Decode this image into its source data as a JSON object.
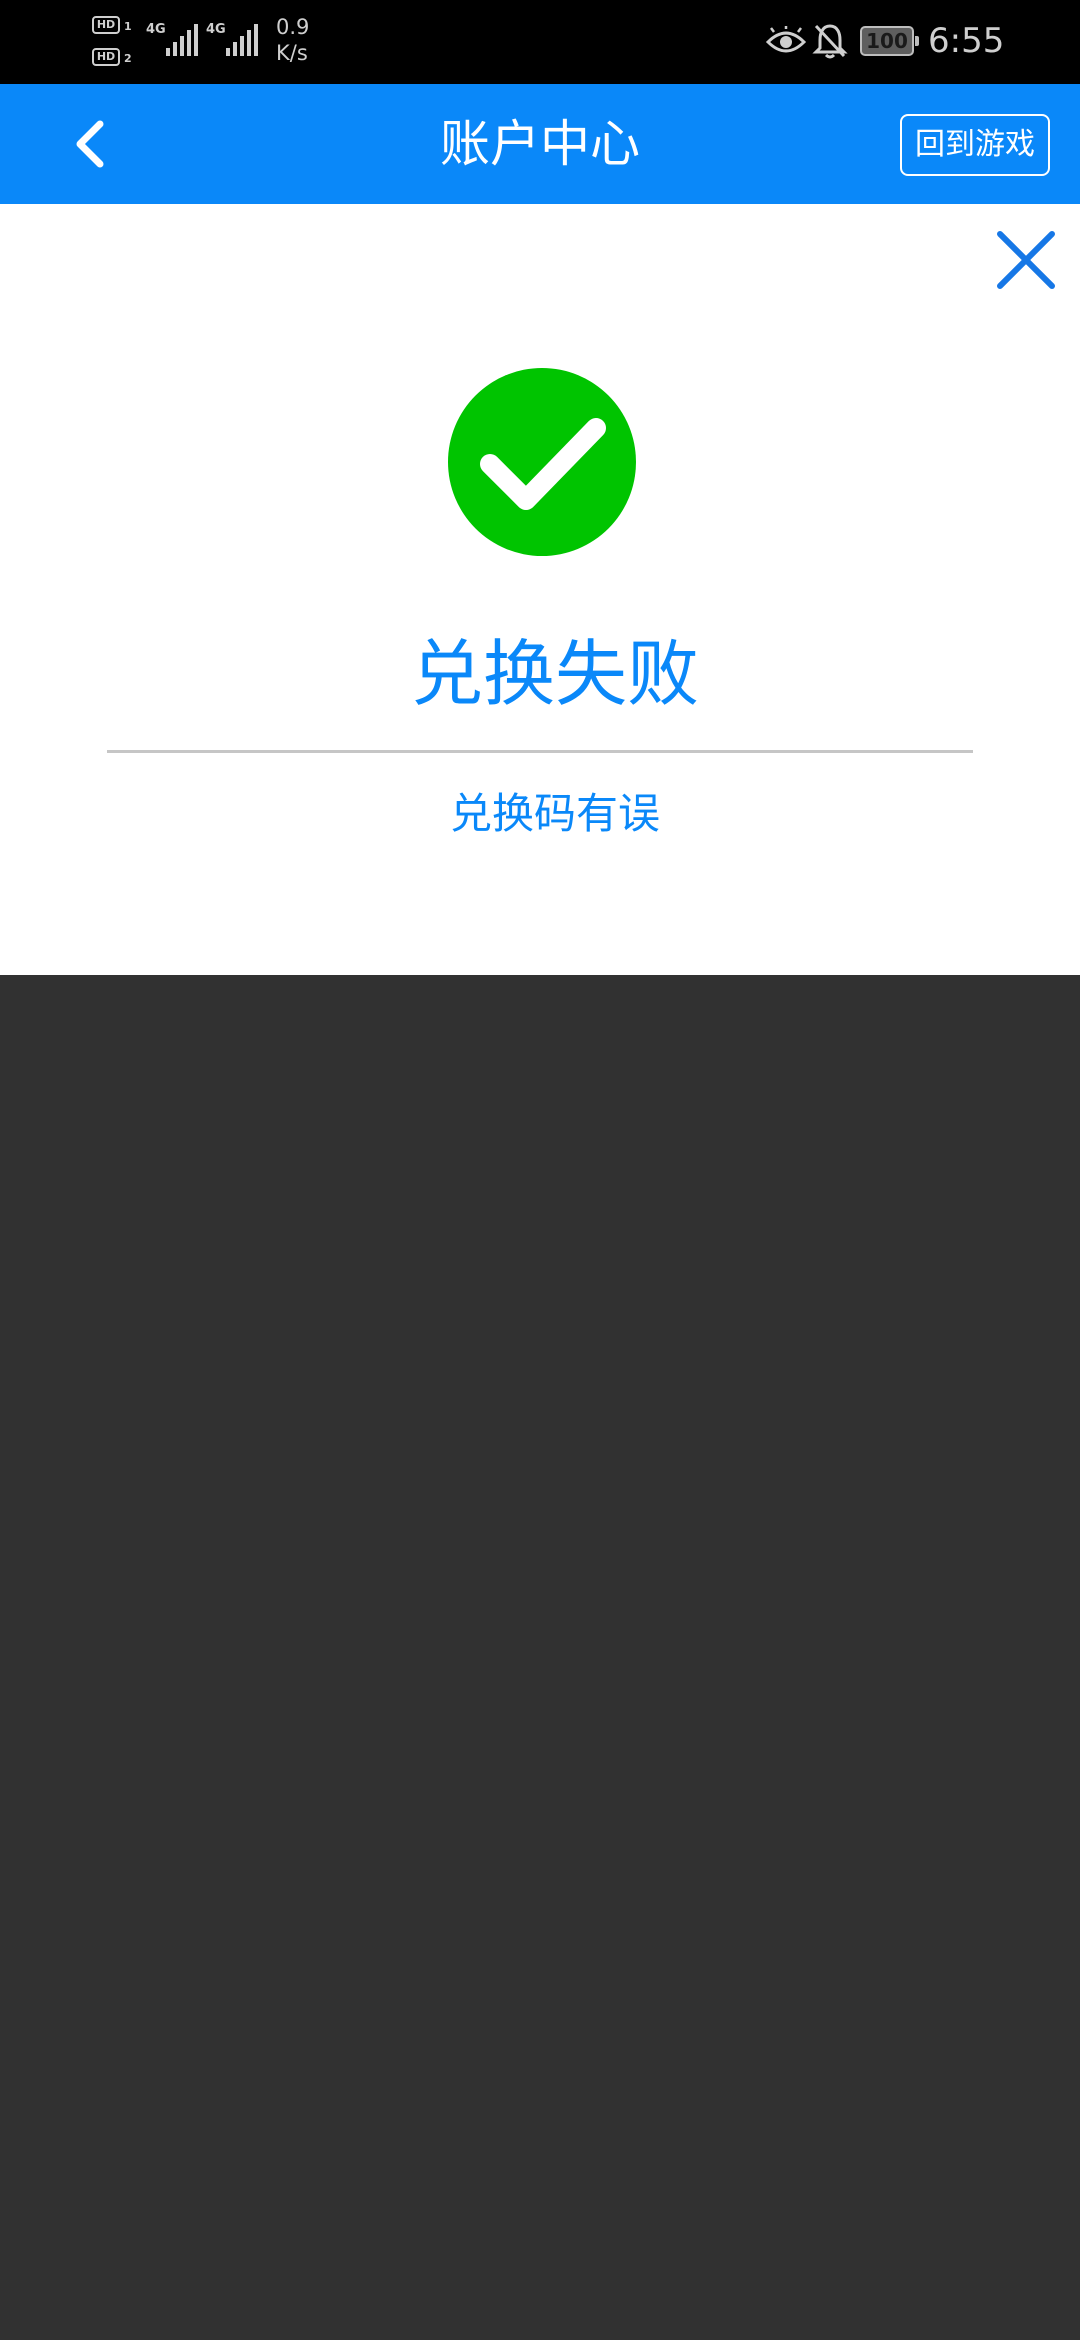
{
  "status_bar": {
    "sim1_tag": "HD",
    "sim1_number": "1",
    "sim2_tag": "HD",
    "sim2_number": "2",
    "network1": "4G",
    "network2": "4G",
    "speed_value": "0.9",
    "speed_unit": "K/s",
    "battery_level": "100",
    "time": "6:55",
    "icons": [
      "eye-icon",
      "bell-off-icon",
      "battery-icon",
      "signal-icon"
    ]
  },
  "header": {
    "title": "账户中心",
    "back_icon": "chevron-left-icon",
    "return_button_label": "回到游戏",
    "background_color": "#0a88f9"
  },
  "result": {
    "close_icon": "close-icon",
    "status_icon": "check-circle-icon",
    "status_icon_color": "#00c400",
    "title": "兑换失败",
    "message": "兑换码有误",
    "text_color": "#0a88f9"
  },
  "overlay": {
    "color": "#313131"
  }
}
